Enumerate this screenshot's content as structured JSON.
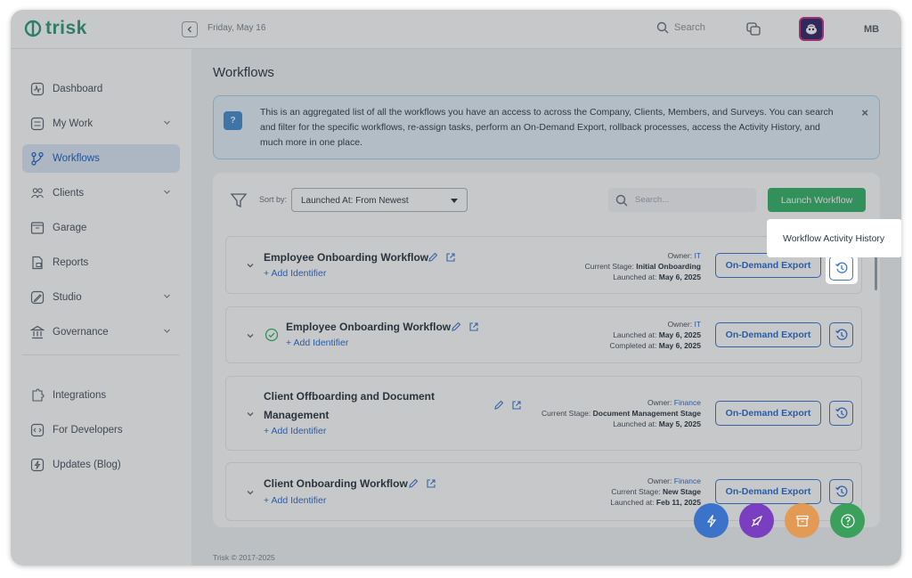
{
  "app": {
    "brand": "trisk",
    "date": "Friday, May 16",
    "user_initials": "MB"
  },
  "topbar": {
    "search_label": "Search"
  },
  "colors": {
    "brand": "#2f9e7e",
    "primary": "#2f6fd0",
    "success": "#38b46b",
    "active_nav_bg": "#dde9f7"
  },
  "sidebar": {
    "items": [
      {
        "label": "Dashboard",
        "icon": "dashboard-icon",
        "has_children": false,
        "active": false
      },
      {
        "label": "My Work",
        "icon": "my-work-icon",
        "has_children": true,
        "active": false
      },
      {
        "label": "Workflows",
        "icon": "workflows-icon",
        "has_children": false,
        "active": true
      },
      {
        "label": "Clients",
        "icon": "clients-icon",
        "has_children": true,
        "active": false
      },
      {
        "label": "Garage",
        "icon": "garage-icon",
        "has_children": false,
        "active": false
      },
      {
        "label": "Reports",
        "icon": "reports-icon",
        "has_children": false,
        "active": false
      },
      {
        "label": "Studio",
        "icon": "studio-icon",
        "has_children": true,
        "active": false
      },
      {
        "label": "Governance",
        "icon": "governance-icon",
        "has_children": true,
        "active": false
      },
      {
        "label": "Integrations",
        "icon": "integrations-icon",
        "has_children": false,
        "active": false
      },
      {
        "label": "For Developers",
        "icon": "code-icon",
        "has_children": false,
        "active": false
      },
      {
        "label": "Updates (Blog)",
        "icon": "updates-icon",
        "has_children": false,
        "active": false
      }
    ]
  },
  "main": {
    "title": "Workflows",
    "info": {
      "badge": "?",
      "text": "This is an aggregated list of all the workflows you have an access to across the Company, Clients, Members, and Surveys. You can search and filter for the specific workflows, re-assign tasks, perform an On-Demand Export, rollback processes, access the Activity History, and much more in one place.",
      "close": "×"
    },
    "sort_label": "Sort by:",
    "sort_value": "Launched At: From Newest",
    "search_placeholder": "Search...",
    "launch_button": "Launch Workflow",
    "export_label": "On-Demand Export",
    "add_identifier": "+  Add Identifier",
    "footer": "Trisk © 2017-2025"
  },
  "workflows": [
    {
      "title": "Employee Onboarding Workflow",
      "completed": false,
      "meta": [
        {
          "k": "Owner:",
          "v": "IT",
          "link": true
        },
        {
          "k": "Current Stage:",
          "v": "Initial Onboarding",
          "link": false
        },
        {
          "k": "Launched at:",
          "v": "May 6, 2025",
          "link": false
        }
      ]
    },
    {
      "title": "Employee Onboarding Workflow",
      "completed": true,
      "meta": [
        {
          "k": "Owner:",
          "v": "IT",
          "link": true
        },
        {
          "k": "Launched at:",
          "v": "May 6, 2025",
          "link": false
        },
        {
          "k": "Completed at:",
          "v": "May 6, 2025",
          "link": false
        }
      ]
    },
    {
      "title_line1": "Client Offboarding and Document",
      "title_line2": "Management",
      "completed": false,
      "meta": [
        {
          "k": "Owner:",
          "v": "Finance",
          "link": true
        },
        {
          "k": "Current Stage:",
          "v": "Document Management Stage",
          "link": false
        },
        {
          "k": "Launched at:",
          "v": "May 5, 2025",
          "link": false
        }
      ]
    },
    {
      "title": "Client Onboarding Workflow",
      "completed": false,
      "meta": [
        {
          "k": "Owner:",
          "v": "Finance",
          "link": true
        },
        {
          "k": "Current Stage:",
          "v": "New Stage",
          "link": false
        },
        {
          "k": "Launched at:",
          "v": "Feb 11, 2025",
          "link": false
        }
      ]
    }
  ],
  "tooltip": "Workflow Activity History",
  "fabs": [
    {
      "icon": "lightning-icon",
      "color": "#3a73c9"
    },
    {
      "icon": "rocket-icon",
      "color": "#7a3fc1"
    },
    {
      "icon": "archive-icon",
      "color": "#e39a55"
    },
    {
      "icon": "help-icon",
      "color": "#3aa05c"
    }
  ]
}
